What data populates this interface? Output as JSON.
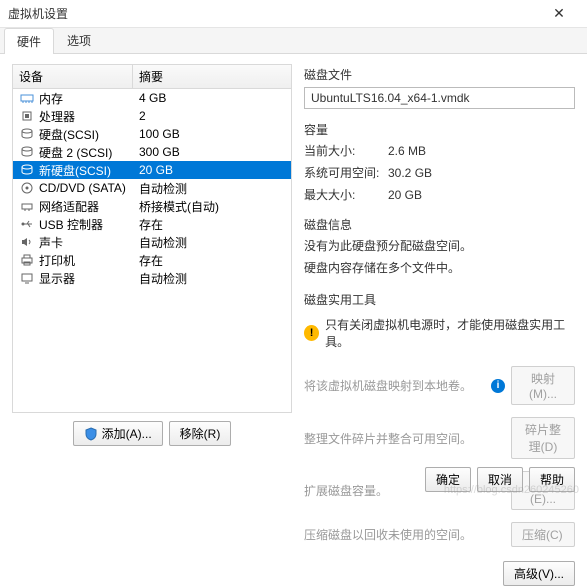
{
  "window": {
    "title": "虚拟机设置"
  },
  "tabs": [
    {
      "label": "硬件",
      "active": true
    },
    {
      "label": "选项",
      "active": false
    }
  ],
  "hw_header": {
    "device": "设备",
    "summary": "摘要"
  },
  "hw": [
    {
      "icon": "memory",
      "name": "内存",
      "summary": "4 GB",
      "sel": false
    },
    {
      "icon": "cpu",
      "name": "处理器",
      "summary": "2",
      "sel": false
    },
    {
      "icon": "disk",
      "name": "硬盘(SCSI)",
      "summary": "100 GB",
      "sel": false
    },
    {
      "icon": "disk",
      "name": "硬盘 2 (SCSI)",
      "summary": "300 GB",
      "sel": false
    },
    {
      "icon": "disk",
      "name": "新硬盘(SCSI)",
      "summary": "20 GB",
      "sel": true
    },
    {
      "icon": "cd",
      "name": "CD/DVD (SATA)",
      "summary": "自动检测",
      "sel": false
    },
    {
      "icon": "net",
      "name": "网络适配器",
      "summary": "桥接模式(自动)",
      "sel": false
    },
    {
      "icon": "usb",
      "name": "USB 控制器",
      "summary": "存在",
      "sel": false
    },
    {
      "icon": "sound",
      "name": "声卡",
      "summary": "自动检测",
      "sel": false
    },
    {
      "icon": "printer",
      "name": "打印机",
      "summary": "存在",
      "sel": false
    },
    {
      "icon": "display",
      "name": "显示器",
      "summary": "自动检测",
      "sel": false
    }
  ],
  "left_buttons": {
    "add": "添加(A)...",
    "remove": "移除(R)"
  },
  "right": {
    "disk_file_label": "磁盘文件",
    "disk_file_value": "UbuntuLTS16.04_x64-1.vmdk",
    "capacity_label": "容量",
    "current_size_k": "当前大小:",
    "current_size_v": "2.6 MB",
    "sys_free_k": "系统可用空间:",
    "sys_free_v": "30.2 GB",
    "max_size_k": "最大大小:",
    "max_size_v": "20 GB",
    "disk_info_label": "磁盘信息",
    "disk_info_l1": "没有为此硬盘预分配磁盘空间。",
    "disk_info_l2": "硬盘内容存储在多个文件中。",
    "utils_label": "磁盘实用工具",
    "utils_warn": "只有关闭虚拟机电源时，才能使用磁盘实用工具。",
    "u1_text": "将该虚拟机磁盘映射到本地卷。",
    "u1_btn": "映射(M)...",
    "u2_text": "整理文件碎片并整合可用空间。",
    "u2_btn": "碎片整理(D)",
    "u3_text": "扩展磁盘容量。",
    "u3_btn": "扩展(E)...",
    "u4_text": "压缩磁盘以回收未使用的空间。",
    "u4_btn": "压缩(C)",
    "adv_btn": "高级(V)..."
  },
  "footer": {
    "ok": "确定",
    "cancel": "取消",
    "help": "帮助"
  },
  "watermark": "https://blog.csdn260245260"
}
